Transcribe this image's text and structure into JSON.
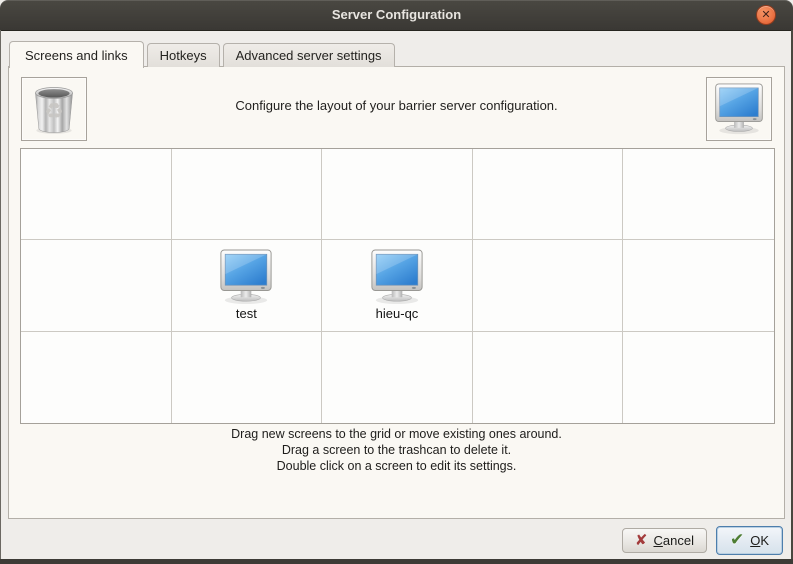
{
  "window": {
    "title": "Server Configuration"
  },
  "icons": {
    "close": "✕",
    "cancel_x": "✘",
    "ok_check": "✔",
    "recycle": "♻"
  },
  "tabs": [
    {
      "label": "Screens and links",
      "active": true
    },
    {
      "label": "Hotkeys",
      "active": false
    },
    {
      "label": "Advanced server settings",
      "active": false
    }
  ],
  "panel": {
    "header_text": "Configure the layout of your barrier server configuration.",
    "grid": {
      "rows": 3,
      "cols": 5,
      "screens": [
        {
          "name": "test",
          "row": 2,
          "col": 2
        },
        {
          "name": "hieu-qc",
          "row": 2,
          "col": 3
        }
      ]
    },
    "instructions": [
      "Drag new screens to the grid or move existing ones around.",
      "Drag a screen to the trashcan to delete it.",
      "Double click on a screen to edit its settings."
    ]
  },
  "buttons": {
    "cancel": {
      "mnemonic": "C",
      "rest": "ancel"
    },
    "ok": {
      "mnemonic": "O",
      "rest": "K"
    }
  },
  "colors": {
    "titlebar": "#3f3d38",
    "close_button": "#e86636",
    "dialog_bg": "#efedea",
    "pane_bg": "#faf8f3",
    "grid_bg": "#fdfdfc",
    "grid_border": "#ccc9c3",
    "ok_focus_border": "#4d7eac",
    "cancel_icon": "#a33c3c",
    "ok_icon": "#4d7d33",
    "screen_blue": "#3f8fdb"
  }
}
